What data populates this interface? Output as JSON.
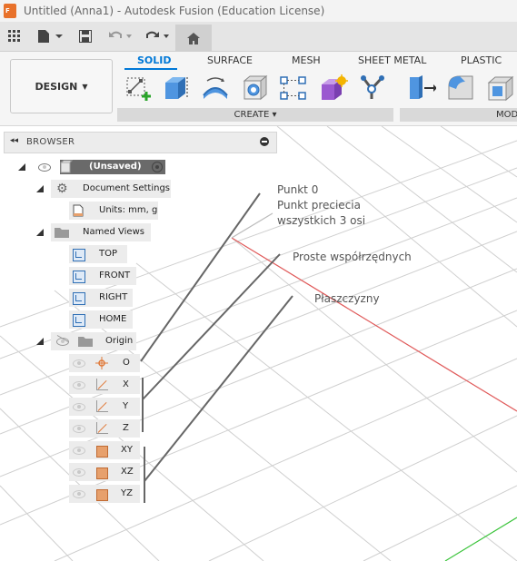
{
  "window": {
    "title": "Untitled (Anna1) - Autodesk Fusion (Education License)",
    "app_badge": "F"
  },
  "toolbar": {
    "icons": [
      "grid-icon",
      "file-icon",
      "save-icon",
      "undo-icon",
      "redo-icon",
      "home-icon"
    ]
  },
  "ribbon": {
    "workspace": "DESIGN",
    "tabs": [
      "SOLID",
      "SURFACE",
      "MESH",
      "SHEET METAL",
      "PLASTIC"
    ],
    "active_tab": "SOLID",
    "create_label": "CREATE",
    "modify_label": "MOD",
    "tools": [
      "new-component-icon",
      "extrude-icon",
      "revolve-icon",
      "hole-icon",
      "pattern-icon",
      "create-form-icon",
      "joint-icon",
      "press-pull-icon",
      "fillet-icon",
      "shell-icon"
    ]
  },
  "browser": {
    "title": "BROWSER",
    "root": "(Unsaved)",
    "document_settings": "Document Settings",
    "units": "Units: mm, g",
    "named_views": "Named Views",
    "views": [
      "TOP",
      "FRONT",
      "RIGHT",
      "HOME"
    ],
    "origin": "Origin",
    "origin_items": [
      "O",
      "X",
      "Y",
      "Z",
      "XY",
      "XZ",
      "YZ"
    ]
  },
  "annotations": {
    "point": [
      "Punkt 0",
      "Punkt preciecia",
      "wszystkich 3 osi"
    ],
    "axes": "Proste współrzędnych",
    "planes": "Płaszczyzny"
  },
  "colors": {
    "accent": "#0078d7",
    "x_axis": "#e05a5a",
    "y_axis": "#3cc43c",
    "grid": "#c8c8c8"
  }
}
